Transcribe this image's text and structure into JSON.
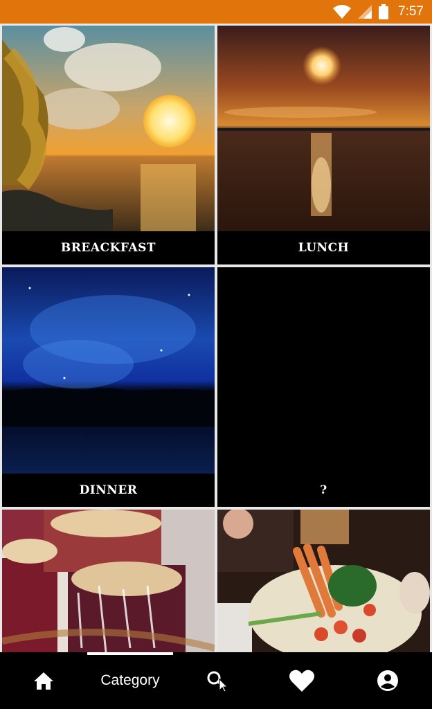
{
  "status_bar": {
    "time": "7:57",
    "background_color": "#e2740c",
    "icons": [
      "wifi-icon",
      "signal-icon",
      "battery-icon"
    ]
  },
  "categories": [
    {
      "label": "BREACKFAST",
      "image": "sunset over sea with tree"
    },
    {
      "label": "LUNCH",
      "image": "sun over beach"
    },
    {
      "label": "DINNER",
      "image": "starry blue night sky"
    },
    {
      "label": "?",
      "image": ""
    },
    {
      "label": "",
      "image": "berry crumble bars"
    },
    {
      "label": "",
      "image": "platter of vegetables and meats"
    }
  ],
  "bottom_nav": {
    "items": [
      {
        "icon": "home-icon"
      },
      {
        "label": "Category",
        "selected": true
      },
      {
        "icon": "search-icon"
      },
      {
        "icon": "heart-icon"
      },
      {
        "icon": "account-icon"
      }
    ]
  }
}
